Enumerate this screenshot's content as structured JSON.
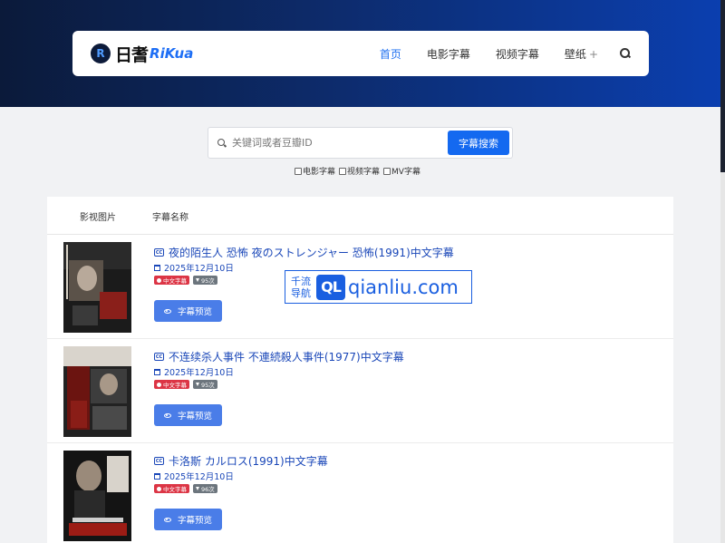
{
  "brand": {
    "logo_mark": "R",
    "name_cn": "日耆",
    "name_en": "RiKua"
  },
  "nav": {
    "items": [
      {
        "label": "首页",
        "active": true
      },
      {
        "label": "电影字幕",
        "active": false
      },
      {
        "label": "视频字幕",
        "active": false
      },
      {
        "label": "壁纸",
        "active": false,
        "has_plus": true
      }
    ],
    "plus": "+",
    "search_icon": "search-icon"
  },
  "search": {
    "placeholder": "关键词或者豆瓣ID",
    "value": "",
    "button_label": "字幕搜索"
  },
  "filters": [
    {
      "label": "电影字幕",
      "checked": false
    },
    {
      "label": "视频字幕",
      "checked": false
    },
    {
      "label": "MV字幕",
      "checked": false
    }
  ],
  "table": {
    "headers": {
      "image": "影视图片",
      "name": "字幕名称"
    },
    "rows": [
      {
        "cc": "CC",
        "title": "夜的陌生人 恐怖 夜のストレンジャー 恐怖(1991)中文字幕",
        "date": "2025年12月10日",
        "lang_badge": "中文字幕",
        "downloads": "95次",
        "preview_label": "字幕预览"
      },
      {
        "cc": "CC",
        "title": "不连续杀人事件 不連続殺人事件(1977)中文字幕",
        "date": "2025年12月10日",
        "lang_badge": "中文字幕",
        "downloads": "95次",
        "preview_label": "字幕预览"
      },
      {
        "cc": "CC",
        "title": "卡洛斯 カルロス(1991)中文字幕",
        "date": "2025年12月10日",
        "lang_badge": "中文字幕",
        "downloads": "96次",
        "preview_label": "字幕预览"
      }
    ]
  },
  "watermark": {
    "cn_top": "千流",
    "cn_bottom": "导航",
    "logo": "QL",
    "url": "qianliu.com"
  },
  "colors": {
    "accent": "#1469f0",
    "link": "#1a47b8",
    "badge_red": "#dc3545",
    "badge_gray": "#6c757d"
  }
}
